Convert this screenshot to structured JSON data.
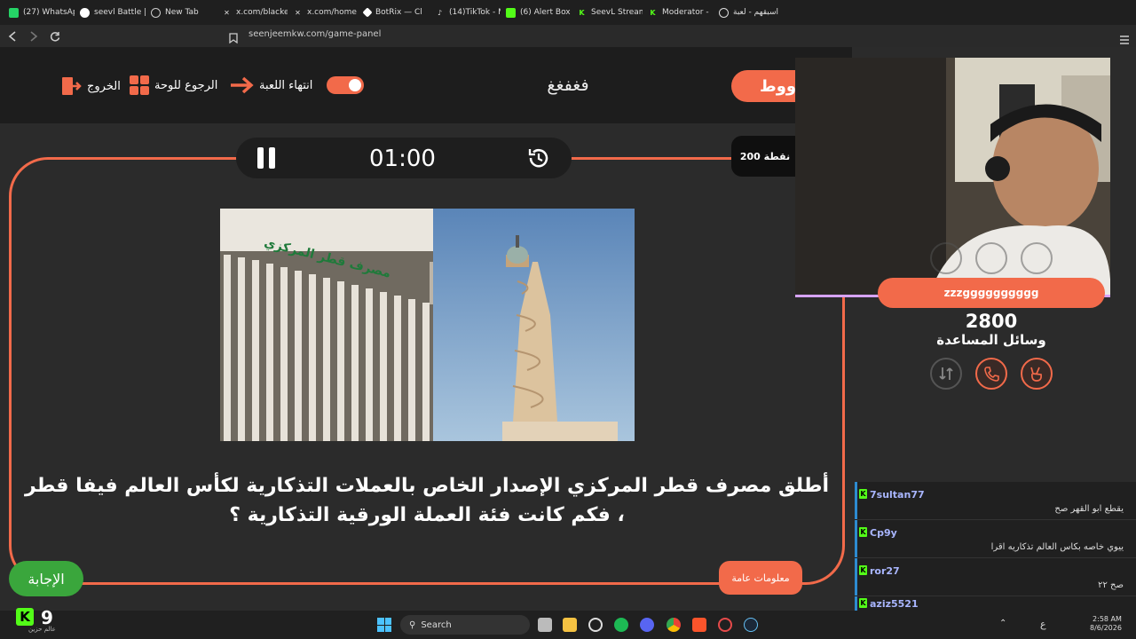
{
  "browser": {
    "tabs": [
      {
        "label": "(27) WhatsApp",
        "icon": "whatsapp-icon",
        "color": "#25d366"
      },
      {
        "label": "seevl Battle |",
        "icon": "seevl-icon",
        "color": "#ffffff"
      },
      {
        "label": "New Tab",
        "icon": "shield-icon",
        "color": "#cccccc"
      },
      {
        "label": "x.com/blacke",
        "icon": "x-icon",
        "color": "#ffffff"
      },
      {
        "label": "x.com/home",
        "icon": "x-icon",
        "color": "#ffffff"
      },
      {
        "label": "BotRix — Cl",
        "icon": "botrix-icon",
        "color": "#ffffff"
      },
      {
        "label": "(14)TikTok - M",
        "icon": "tiktok-icon",
        "color": "#ffffff"
      },
      {
        "label": "(6) Alert Box",
        "icon": "alert-icon",
        "color": "#53fc18"
      },
      {
        "label": "SeevL Stream",
        "icon": "kick-icon",
        "color": "#53fc18"
      },
      {
        "label": "Moderator -",
        "icon": "kick-icon",
        "color": "#53fc18"
      },
      {
        "label": "اسبقهم - لعبة",
        "icon": "globe-icon",
        "color": "#dddddd"
      }
    ],
    "url": "seenjeemkw.com/game-panel"
  },
  "header": {
    "game_name": "فغفغغ",
    "team_pill": "ووووط",
    "end_game_label": "انتهاء اللعبة",
    "back_to_board_label": "الرجوع للوحة",
    "exit_label": "الخروج"
  },
  "timer": {
    "time": "01:00"
  },
  "points_badge": "200 نقطة",
  "question": {
    "text": "أطلق مصرف قطر المركزي الإصدار الخاص بالعملات التذكارية لكأس العالم فيفا قطر ، فكم كانت فئة العملة الورقية التذكارية ؟",
    "image_sign_text": "مصرف قطر المركزي",
    "category": "معلومات عامة"
  },
  "answer_button": "الإجابة",
  "right_panel": {
    "team_name": "zzzgggggggggg",
    "score": "2800",
    "help_label": "وسائل المساعدة"
  },
  "chat": {
    "messages": [
      {
        "user": "7sultan77",
        "text": "يقطع ابو القهر صح"
      },
      {
        "user": "Cp9y",
        "text": "ييوي خاصه بكاس العالم تذكاريه اقرا"
      },
      {
        "user": "ror27",
        "text": "صح ٢٢"
      },
      {
        "user": "aziz5521",
        "text": ""
      }
    ]
  },
  "taskbar": {
    "search_placeholder": "Search",
    "lang": "ع",
    "time": "2:58 AM",
    "date": "8/6/2026"
  },
  "overlay": {
    "count": "9",
    "sub": "عالم حزين"
  },
  "colors": {
    "accent": "#f26a4a",
    "green": "#3aa63c",
    "kick": "#53fc18"
  }
}
